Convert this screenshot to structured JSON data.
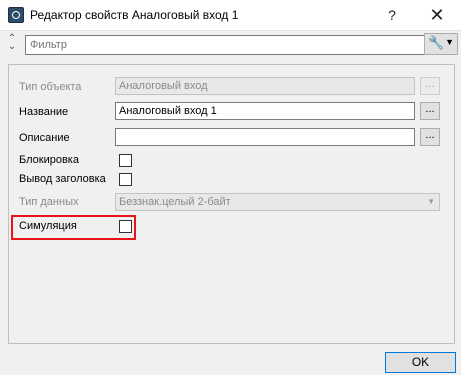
{
  "window": {
    "title": "Редактор свойств Аналоговый вход 1",
    "help_label": "?",
    "close_label": "✕"
  },
  "filter": {
    "placeholder": "Фильтр"
  },
  "properties": {
    "object_type": {
      "label": "Тип объекта",
      "value": "Аналоговый вход",
      "button": "..."
    },
    "name": {
      "label": "Название",
      "value": "Аналоговый вход 1",
      "button": "..."
    },
    "description": {
      "label": "Описание",
      "value": "",
      "button": "..."
    },
    "lock": {
      "label": "Блокировка",
      "checked": false
    },
    "show_header": {
      "label": "Вывод заголовка",
      "checked": false
    },
    "data_type": {
      "label": "Тип данных",
      "value": "Беззнак.целый 2-байт"
    },
    "simulation": {
      "label": "Симуляция",
      "checked": false
    }
  },
  "footer": {
    "ok_label": "OK"
  },
  "colors": {
    "highlight": "#e8141c",
    "ok_border": "#0078d7"
  }
}
